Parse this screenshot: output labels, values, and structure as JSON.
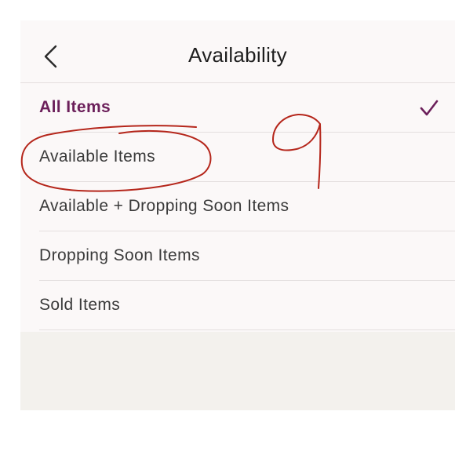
{
  "header": {
    "title": "Availability",
    "back_icon": "chevron-left-icon"
  },
  "options": [
    {
      "label": "All Items",
      "selected": true
    },
    {
      "label": "Available Items",
      "selected": false
    },
    {
      "label": "Available + Dropping Soon Items",
      "selected": false
    },
    {
      "label": "Dropping Soon Items",
      "selected": false
    },
    {
      "label": "Sold Items",
      "selected": false
    }
  ],
  "selected_icon": "checkmark-icon",
  "colors": {
    "accent": "#6b1f5a",
    "annotation": "#b5261b",
    "panel_background": "#fbf8f8",
    "screen_background": "#f3f1ed",
    "divider": "#e4dfdf"
  },
  "annotations": {
    "handwritten_number": "9",
    "circled_option": "Available Items"
  }
}
